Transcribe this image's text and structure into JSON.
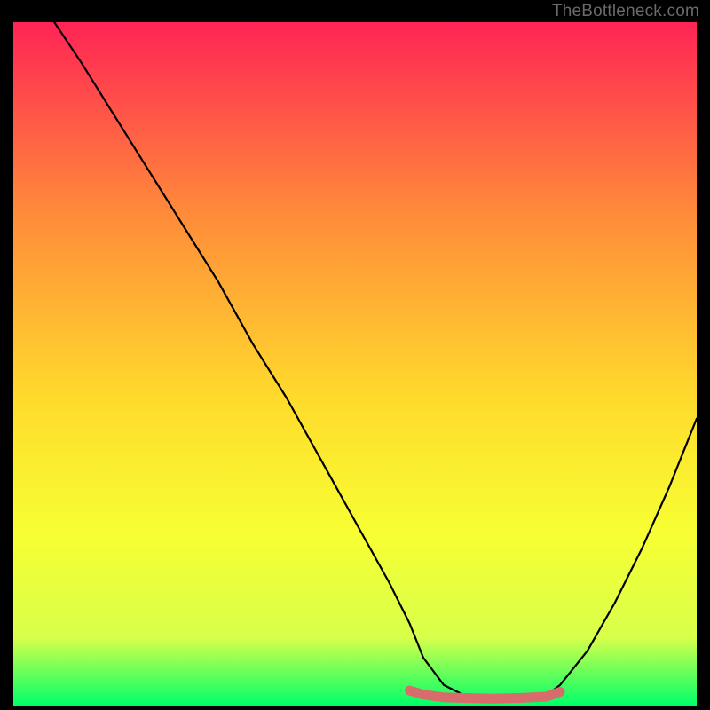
{
  "watermark": "TheBottleneck.com",
  "chart_data": {
    "type": "line",
    "title": "",
    "xlabel": "",
    "ylabel": "",
    "xlim": [
      0,
      100
    ],
    "ylim": [
      0,
      100
    ],
    "background_gradient": {
      "top": "#ff2455",
      "mid_upper": "#ff8b3a",
      "mid": "#ffdb2c",
      "mid_lower": "#f7ff33",
      "lower": "#d8ff4a",
      "bottom": "#00ff6a"
    },
    "series": [
      {
        "name": "curve",
        "color": "#000000",
        "x": [
          6,
          10,
          15,
          20,
          25,
          30,
          35,
          40,
          45,
          50,
          55,
          58,
          60,
          63,
          66,
          70,
          74,
          78,
          80,
          84,
          88,
          92,
          96,
          100
        ],
        "values": [
          100,
          94,
          86,
          78,
          70,
          62,
          53,
          45,
          36,
          27,
          18,
          12,
          7,
          3,
          1.5,
          1,
          1,
          1.5,
          3,
          8,
          15,
          23,
          32,
          42
        ]
      },
      {
        "name": "highlight-zone",
        "color": "#d86b6b",
        "x": [
          58,
          60,
          63,
          66,
          70,
          74,
          78,
          80
        ],
        "values": [
          2.2,
          1.6,
          1.2,
          1.1,
          1.0,
          1.1,
          1.3,
          2.0
        ]
      }
    ]
  }
}
